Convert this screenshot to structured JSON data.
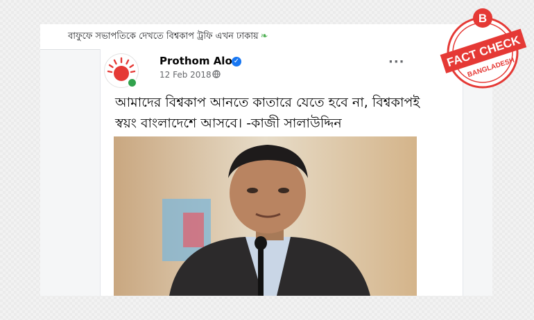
{
  "headline": {
    "text": "বাফুফে সভাপতিকে দেখতে বিশ্বকাপ ট্রফি এখন ঢাকায়"
  },
  "post": {
    "page_name": "Prothom Alo",
    "date": "12 Feb 2018",
    "privacy_icon": "globe-icon",
    "more_icon": "more-options-icon",
    "verified_icon": "verified-check-icon",
    "text": "আমাদের বিশ্বকাপ আনতে কাতারে যেতে হবে না, বিশ্বকাপই স্বয়ং বাংলাদেশে আসবে। -কাজী সালাউদ্দিন"
  },
  "badge": {
    "letter": "B",
    "main": "FACT CHECK",
    "sub": "BANGLADESH",
    "color": "#e53935"
  },
  "colors": {
    "brand_red": "#e53935",
    "verified_blue": "#1877f2",
    "online_green": "#31a24c"
  }
}
